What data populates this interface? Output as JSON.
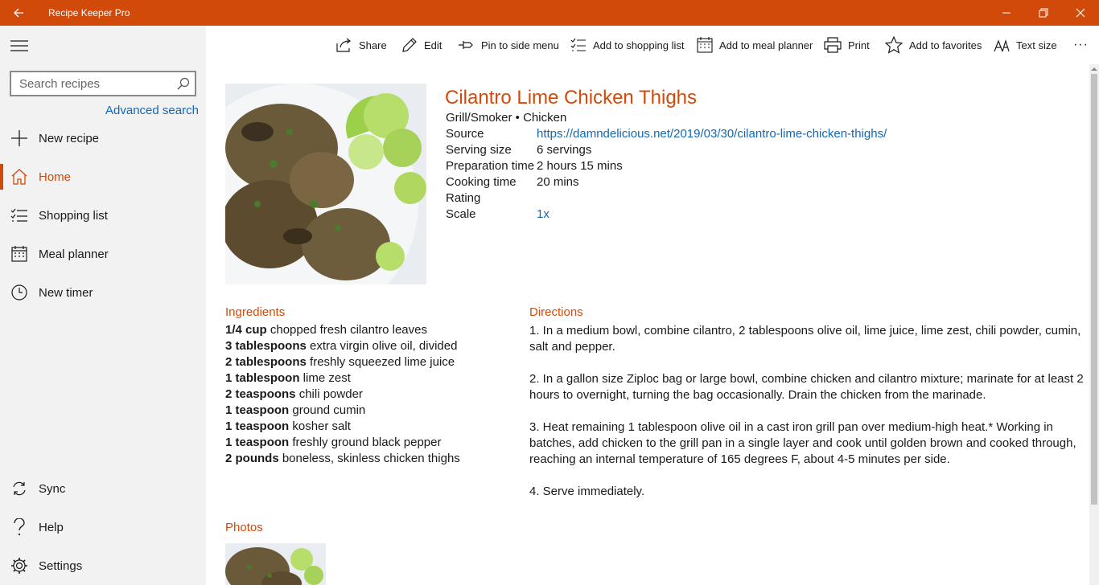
{
  "window": {
    "title": "Recipe Keeper Pro",
    "accent": "#d24a0a",
    "link_color": "#1467b3"
  },
  "sidebar": {
    "search_placeholder": "Search recipes",
    "advanced_search": "Advanced search",
    "items_top": [
      {
        "label": "New recipe",
        "icon": "plus-icon"
      },
      {
        "label": "Home",
        "icon": "home-icon",
        "active": true
      },
      {
        "label": "Shopping list",
        "icon": "checklist-icon"
      },
      {
        "label": "Meal planner",
        "icon": "calendar-icon"
      },
      {
        "label": "New timer",
        "icon": "clock-icon"
      }
    ],
    "items_bottom": [
      {
        "label": "Sync",
        "icon": "sync-icon"
      },
      {
        "label": "Help",
        "icon": "help-icon"
      },
      {
        "label": "Settings",
        "icon": "gear-icon"
      }
    ]
  },
  "toolbar": {
    "share": "Share",
    "edit": "Edit",
    "pin": "Pin to side menu",
    "shopping": "Add to shopping list",
    "meal": "Add to meal planner",
    "print": "Print",
    "favorites": "Add to favorites",
    "text_size": "Text size",
    "more": "···"
  },
  "recipe": {
    "title": "Cilantro Lime Chicken Thighs",
    "category": "Grill/Smoker • Chicken",
    "meta": [
      {
        "key": "Source",
        "value": "https://damndelicious.net/2019/03/30/cilantro-lime-chicken-thighs/",
        "link": true
      },
      {
        "key": "Serving size",
        "value": "6 servings",
        "link": false
      },
      {
        "key": "Preparation time",
        "value": "2 hours 15 mins",
        "link": false
      },
      {
        "key": "Cooking time",
        "value": "20 mins",
        "link": false
      },
      {
        "key": "Rating",
        "value": "",
        "link": false
      },
      {
        "key": "Scale",
        "value": "1x",
        "link": true
      }
    ],
    "ingredients_heading": "Ingredients",
    "ingredients": [
      {
        "qty": "1/4 cup",
        "item": " chopped fresh cilantro leaves"
      },
      {
        "qty": "3 tablespoons",
        "item": " extra virgin olive oil, divided"
      },
      {
        "qty": "2 tablespoons",
        "item": " freshly squeezed lime juice"
      },
      {
        "qty": "1 tablespoon",
        "item": " lime zest"
      },
      {
        "qty": "2 teaspoons",
        "item": " chili powder"
      },
      {
        "qty": "1 teaspoon",
        "item": " ground cumin"
      },
      {
        "qty": "1 teaspoon",
        "item": " kosher salt"
      },
      {
        "qty": "1 teaspoon",
        "item": " freshly ground black pepper"
      },
      {
        "qty": "2 pounds",
        "item": " boneless, skinless chicken thighs"
      }
    ],
    "directions_heading": "Directions",
    "directions": [
      "1. In a medium bowl, combine cilantro, 2 tablespoons olive oil, lime juice, lime zest, chili powder, cumin, salt and pepper.",
      "2. In a gallon size Ziploc bag or large bowl, combine chicken and cilantro mixture; marinate for at least 2 hours to overnight, turning the bag occasionally. Drain the chicken from the marinade.",
      "3. Heat remaining 1 tablespoon olive oil in a cast iron grill pan over medium-high heat.* Working in batches, add chicken to the grill pan in a single layer and cook until golden brown and cooked through, reaching an internal temperature of 165 degrees F, about 4-5 minutes per side.",
      "4. Serve immediately."
    ],
    "photos_heading": "Photos"
  }
}
